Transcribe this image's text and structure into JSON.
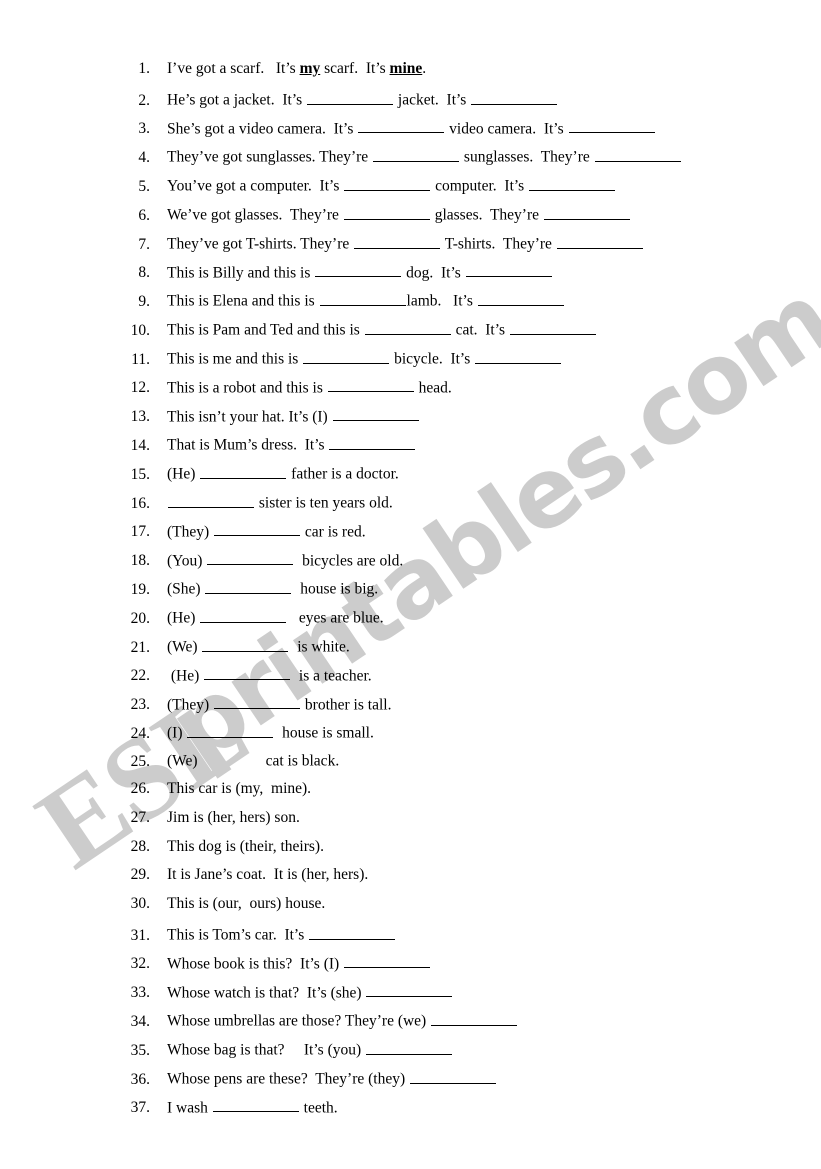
{
  "document": {
    "type": "esl-grammar-worksheet",
    "topic": "Possessive adjectives and possessive pronouns",
    "page_background": "#ffffff",
    "text_color": "#000000"
  },
  "watermark": {
    "part1": "ESL",
    "part2": "printables.com",
    "full_text": "ESLprintables.com",
    "color": "#cccccc",
    "rotation_deg": -34
  },
  "items": [
    {
      "number": "1.",
      "segments": [
        {
          "kind": "text",
          "value": "I’ve got a scarf.   It’s "
        },
        {
          "kind": "bold-underline",
          "value": "my"
        },
        {
          "kind": "text",
          "value": " scarf.  It’s "
        },
        {
          "kind": "bold-underline",
          "value": "mine"
        },
        {
          "kind": "text",
          "value": "."
        }
      ]
    },
    {
      "number": "2.",
      "segments": [
        {
          "kind": "text",
          "value": "He’s got a jacket.  It’s "
        },
        {
          "kind": "blank",
          "width": 86
        },
        {
          "kind": "text",
          "value": " jacket.  It’s "
        },
        {
          "kind": "blank",
          "width": 86
        }
      ]
    },
    {
      "number": "3.",
      "segments": [
        {
          "kind": "text",
          "value": "She’s got a video camera.  It’s "
        },
        {
          "kind": "blank",
          "width": 86
        },
        {
          "kind": "text",
          "value": " video camera.  It’s "
        },
        {
          "kind": "blank",
          "width": 86
        }
      ]
    },
    {
      "number": "4.",
      "segments": [
        {
          "kind": "text",
          "value": "They’ve got sunglasses. They’re "
        },
        {
          "kind": "blank",
          "width": 86
        },
        {
          "kind": "text",
          "value": " sunglasses.  They’re "
        },
        {
          "kind": "blank",
          "width": 86
        }
      ]
    },
    {
      "number": "5.",
      "segments": [
        {
          "kind": "text",
          "value": "You’ve got a computer.  It’s "
        },
        {
          "kind": "blank",
          "width": 86
        },
        {
          "kind": "text",
          "value": " computer.  It’s "
        },
        {
          "kind": "blank",
          "width": 86
        }
      ]
    },
    {
      "number": "6.",
      "segments": [
        {
          "kind": "text",
          "value": "We’ve got glasses.  They’re "
        },
        {
          "kind": "blank",
          "width": 86
        },
        {
          "kind": "text",
          "value": " glasses.  They’re "
        },
        {
          "kind": "blank",
          "width": 86
        }
      ]
    },
    {
      "number": "7.",
      "segments": [
        {
          "kind": "text",
          "value": "They’ve got T-shirts. They’re "
        },
        {
          "kind": "blank",
          "width": 86
        },
        {
          "kind": "text",
          "value": " T-shirts.  They’re "
        },
        {
          "kind": "blank",
          "width": 86
        }
      ]
    },
    {
      "number": "8.",
      "segments": [
        {
          "kind": "text",
          "value": "This is Billy and this is "
        },
        {
          "kind": "blank",
          "width": 86
        },
        {
          "kind": "text",
          "value": " dog.  It’s "
        },
        {
          "kind": "blank",
          "width": 86
        }
      ]
    },
    {
      "number": "9.",
      "segments": [
        {
          "kind": "text",
          "value": "This is Elena and this is "
        },
        {
          "kind": "blank",
          "width": 86
        },
        {
          "kind": "text",
          "value": "lamb.   It’s "
        },
        {
          "kind": "blank",
          "width": 86
        }
      ]
    },
    {
      "number": "10.",
      "segments": [
        {
          "kind": "text",
          "value": "This is Pam and Ted and this is "
        },
        {
          "kind": "blank",
          "width": 86
        },
        {
          "kind": "text",
          "value": " cat.  It’s "
        },
        {
          "kind": "blank",
          "width": 86
        }
      ]
    },
    {
      "number": "11.",
      "segments": [
        {
          "kind": "text",
          "value": "This is me and this is "
        },
        {
          "kind": "blank",
          "width": 86
        },
        {
          "kind": "text",
          "value": " bicycle.  It’s "
        },
        {
          "kind": "blank",
          "width": 86
        }
      ]
    },
    {
      "number": "12.",
      "segments": [
        {
          "kind": "text",
          "value": "This is a robot and this is "
        },
        {
          "kind": "blank",
          "width": 86
        },
        {
          "kind": "text",
          "value": " head."
        }
      ]
    },
    {
      "number": "13.",
      "segments": [
        {
          "kind": "text",
          "value": "This isn’t your hat. It’s (I) "
        },
        {
          "kind": "blank",
          "width": 86
        }
      ]
    },
    {
      "number": "14.",
      "segments": [
        {
          "kind": "text",
          "value": "That is Mum’s dress.  It’s "
        },
        {
          "kind": "blank",
          "width": 86
        }
      ]
    },
    {
      "number": "15.",
      "segments": [
        {
          "kind": "text",
          "value": "(He) "
        },
        {
          "kind": "blank",
          "width": 86
        },
        {
          "kind": "text",
          "value": " father is a doctor."
        }
      ]
    },
    {
      "number": "16.",
      "segments": [
        {
          "kind": "blank",
          "width": 86
        },
        {
          "kind": "text",
          "value": " sister is ten years old."
        }
      ]
    },
    {
      "number": "17.",
      "segments": [
        {
          "kind": "text",
          "value": "(They) "
        },
        {
          "kind": "blank",
          "width": 86
        },
        {
          "kind": "text",
          "value": " car is red."
        }
      ]
    },
    {
      "number": "18.",
      "segments": [
        {
          "kind": "text",
          "value": "(You) "
        },
        {
          "kind": "blank",
          "width": 86
        },
        {
          "kind": "text",
          "value": "  bicycles are old."
        }
      ]
    },
    {
      "number": "19.",
      "segments": [
        {
          "kind": "text",
          "value": "(She) "
        },
        {
          "kind": "blank",
          "width": 86
        },
        {
          "kind": "text",
          "value": "  house is big."
        }
      ]
    },
    {
      "number": "20.",
      "segments": [
        {
          "kind": "text",
          "value": "(He) "
        },
        {
          "kind": "blank",
          "width": 86
        },
        {
          "kind": "text",
          "value": "   eyes are blue."
        }
      ]
    },
    {
      "number": "21.",
      "segments": [
        {
          "kind": "text",
          "value": "(We) "
        },
        {
          "kind": "blank",
          "width": 86
        },
        {
          "kind": "text",
          "value": "  is white."
        }
      ]
    },
    {
      "number": "22.",
      "segments": [
        {
          "kind": "text",
          "value": " (He) "
        },
        {
          "kind": "blank",
          "width": 86
        },
        {
          "kind": "text",
          "value": "  is a teacher."
        }
      ]
    },
    {
      "number": "23.",
      "segments": [
        {
          "kind": "text",
          "value": "(They) "
        },
        {
          "kind": "blank",
          "width": 86
        },
        {
          "kind": "text",
          "value": " brother is tall."
        }
      ]
    },
    {
      "number": "24.",
      "segments": [
        {
          "kind": "text",
          "value": "(I) "
        },
        {
          "kind": "blank",
          "width": 86
        },
        {
          "kind": "text",
          "value": "  house is small."
        }
      ]
    },
    {
      "number": "25.",
      "segments": [
        {
          "kind": "text",
          "value": "(We)"
        },
        {
          "kind": "gap",
          "width": 68
        },
        {
          "kind": "text",
          "value": "cat is black."
        }
      ]
    },
    {
      "number": "26.",
      "segments": [
        {
          "kind": "text",
          "value": "This car is (my,  mine)."
        }
      ]
    },
    {
      "number": "27.",
      "segments": [
        {
          "kind": "text",
          "value": "Jim is (her, hers) son."
        }
      ]
    },
    {
      "number": "28.",
      "segments": [
        {
          "kind": "text",
          "value": "This dog is (their, theirs)."
        }
      ]
    },
    {
      "number": "29.",
      "segments": [
        {
          "kind": "text",
          "value": "It is Jane’s coat.  It is (her, hers)."
        }
      ]
    },
    {
      "number": "30.",
      "segments": [
        {
          "kind": "text",
          "value": "This is (our,  ours) house."
        }
      ]
    },
    {
      "number": "31.",
      "segments": [
        {
          "kind": "text",
          "value": "This is Tom’s car.  It’s "
        },
        {
          "kind": "blank",
          "width": 86
        }
      ]
    },
    {
      "number": "32.",
      "segments": [
        {
          "kind": "text",
          "value": "Whose book is this?  It’s (I) "
        },
        {
          "kind": "blank",
          "width": 86
        }
      ]
    },
    {
      "number": "33.",
      "segments": [
        {
          "kind": "text",
          "value": "Whose watch is that?  It’s (she) "
        },
        {
          "kind": "blank",
          "width": 86
        }
      ]
    },
    {
      "number": "34.",
      "segments": [
        {
          "kind": "text",
          "value": "Whose umbrellas are those? They’re (we) "
        },
        {
          "kind": "blank",
          "width": 86
        }
      ]
    },
    {
      "number": "35.",
      "segments": [
        {
          "kind": "text",
          "value": "Whose bag is that?     It’s (you) "
        },
        {
          "kind": "blank",
          "width": 86
        }
      ]
    },
    {
      "number": "36.",
      "segments": [
        {
          "kind": "text",
          "value": "Whose pens are these?  They’re (they) "
        },
        {
          "kind": "blank",
          "width": 86
        }
      ]
    },
    {
      "number": "37.",
      "segments": [
        {
          "kind": "text",
          "value": "I wash "
        },
        {
          "kind": "blank",
          "width": 86
        },
        {
          "kind": "text",
          "value": " teeth."
        }
      ]
    }
  ]
}
